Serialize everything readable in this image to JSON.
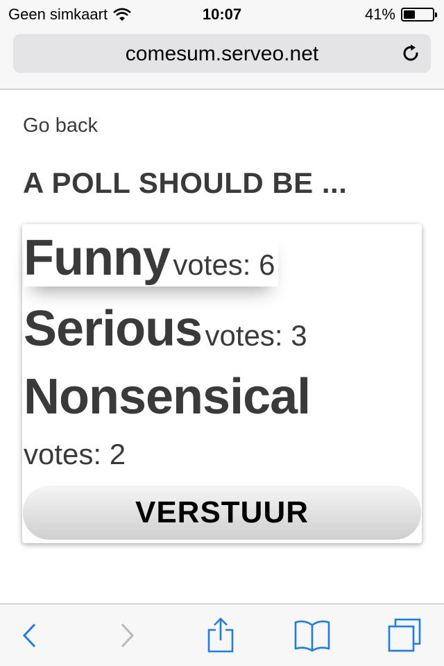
{
  "status_bar": {
    "carrier": "Geen simkaart",
    "time": "10:07",
    "battery": "41%",
    "battery_level": 0.41
  },
  "browser": {
    "url": "comesum.serveo.net"
  },
  "page": {
    "go_back": "Go back",
    "title": "A POLL SHOULD BE ...",
    "options": [
      {
        "label": "Funny",
        "votes": "votes: 6"
      },
      {
        "label": "Serious",
        "votes": "votes: 3"
      },
      {
        "label": "Nonsensical",
        "votes": "votes: 2"
      }
    ],
    "submit": "VERSTUUR"
  },
  "toolbar": {
    "icons": [
      "back-icon",
      "forward-icon",
      "share-icon",
      "bookmarks-icon",
      "tabs-icon"
    ]
  },
  "colors": {
    "accent": "#1a7cf5",
    "text": "#3a3a3a",
    "chrome": "#f7f7f7"
  }
}
